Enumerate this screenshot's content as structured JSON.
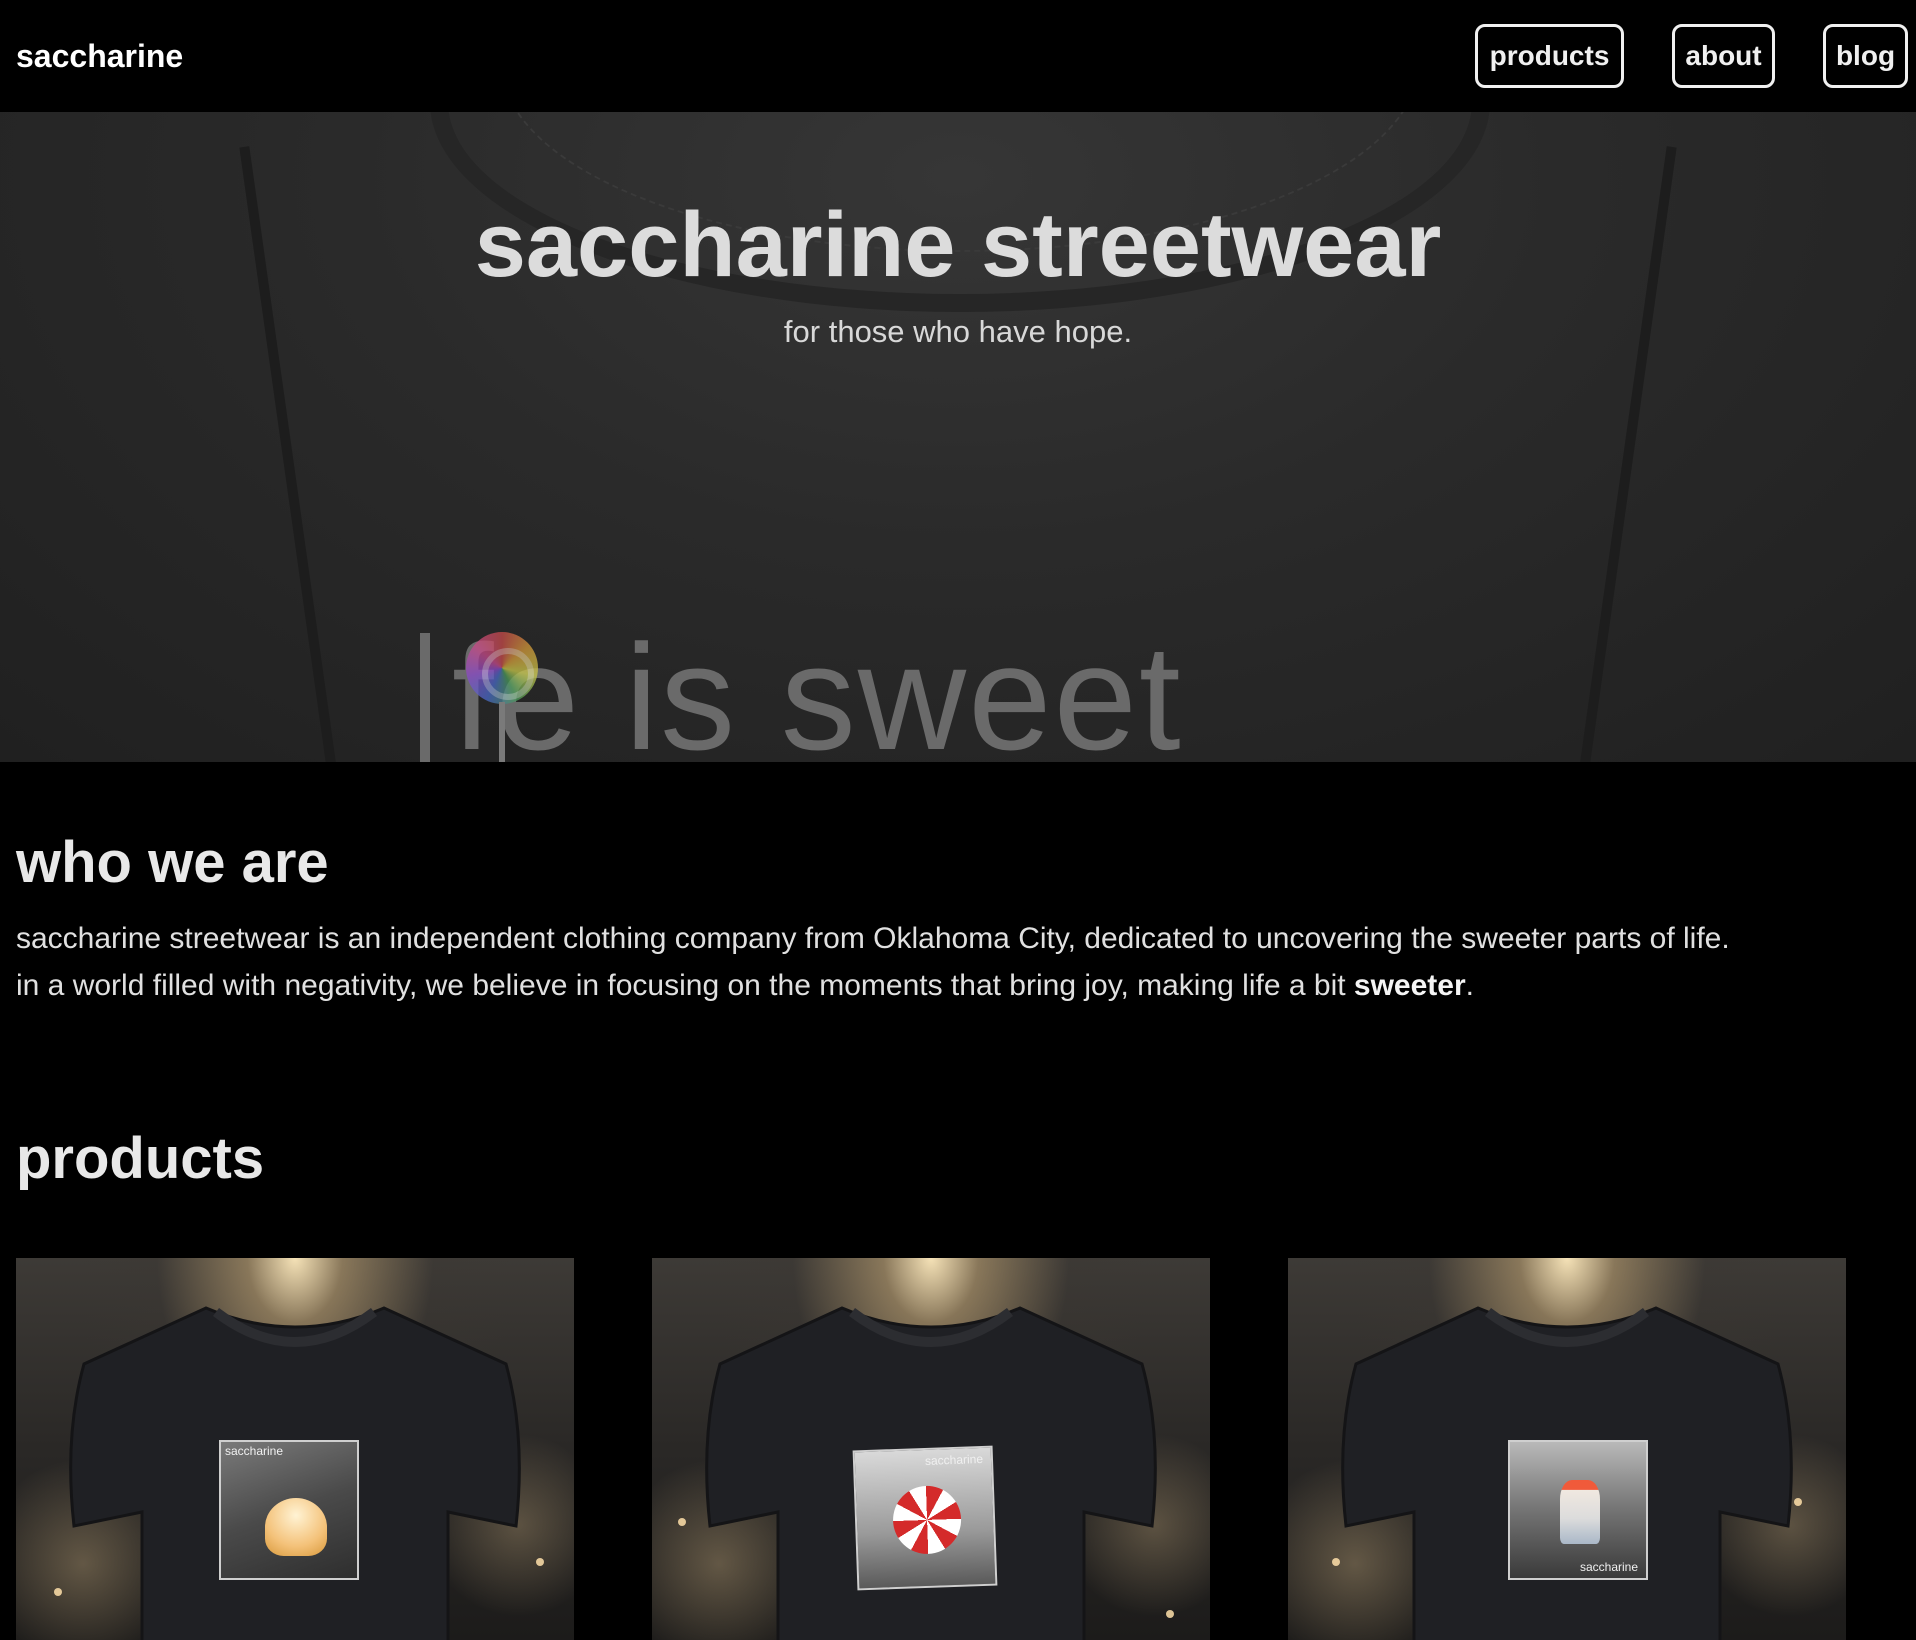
{
  "nav": {
    "brand": "saccharine",
    "links": [
      "products",
      "about",
      "blog"
    ]
  },
  "hero": {
    "title": "saccharine streetwear",
    "subtitle": "for those who have hope.",
    "shirt_print": "fe is sweet"
  },
  "about": {
    "title": "who we are",
    "text_line1": "saccharine streetwear is an independent clothing company from Oklahoma City, dedicated to uncovering the sweeter parts of life.",
    "text_line2_before": "in a world filled with negativity, we believe in focusing on the moments that bring joy, making life a bit ",
    "text_bold": "sweeter",
    "text_after": "."
  },
  "products": {
    "title": "products",
    "items": [
      {
        "design_label": "saccharine",
        "icon": "cake-icon"
      },
      {
        "design_label": "saccharine",
        "icon": "peppermint-icon"
      },
      {
        "design_label": "saccharine",
        "icon": "sundae-icon"
      }
    ]
  },
  "colors": {
    "background": "#000000",
    "text": "#e6e6e6",
    "hero_bg": "#2a2a2a"
  }
}
